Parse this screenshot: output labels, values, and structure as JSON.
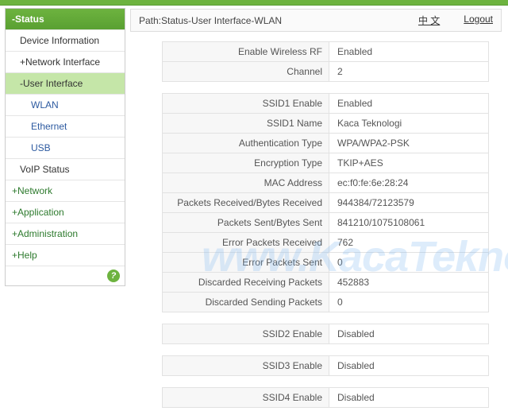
{
  "sidebar": {
    "status": "-Status",
    "device_info": "Device Information",
    "network_interface": "+Network Interface",
    "user_interface": "-User Interface",
    "wlan": "WLAN",
    "ethernet": "Ethernet",
    "usb": "USB",
    "voip_status": "VoIP Status",
    "network": "+Network",
    "application": "+Application",
    "administration": "+Administration",
    "help": "+Help"
  },
  "header": {
    "path": "Path:Status-User Interface-WLAN",
    "lang": "中 文",
    "logout": "Logout"
  },
  "wireless": {
    "enable_rf_label": "Enable Wireless RF",
    "enable_rf_value": "Enabled",
    "channel_label": "Channel",
    "channel_value": "2"
  },
  "ssid1": {
    "enable_label": "SSID1 Enable",
    "enable_value": "Enabled",
    "name_label": "SSID1 Name",
    "name_value": "Kaca Teknologi",
    "auth_label": "Authentication Type",
    "auth_value": "WPA/WPA2-PSK",
    "enc_label": "Encryption Type",
    "enc_value": "TKIP+AES",
    "mac_label": "MAC Address",
    "mac_value": "ec:f0:fe:6e:28:24",
    "prx_label": "Packets Received/Bytes Received",
    "prx_value": "944384/72123579",
    "ptx_label": "Packets Sent/Bytes Sent",
    "ptx_value": "841210/1075108061",
    "erx_label": "Error Packets Received",
    "erx_value": "762",
    "etx_label": "Error Packets Sent",
    "etx_value": "0",
    "drx_label": "Discarded Receiving Packets",
    "drx_value": "452883",
    "dtx_label": "Discarded Sending Packets",
    "dtx_value": "0"
  },
  "ssid2": {
    "label": "SSID2 Enable",
    "value": "Disabled"
  },
  "ssid3": {
    "label": "SSID3 Enable",
    "value": "Disabled"
  },
  "ssid4": {
    "label": "SSID4 Enable",
    "value": "Disabled"
  },
  "watermark": "www.KacaTeknologi.com"
}
